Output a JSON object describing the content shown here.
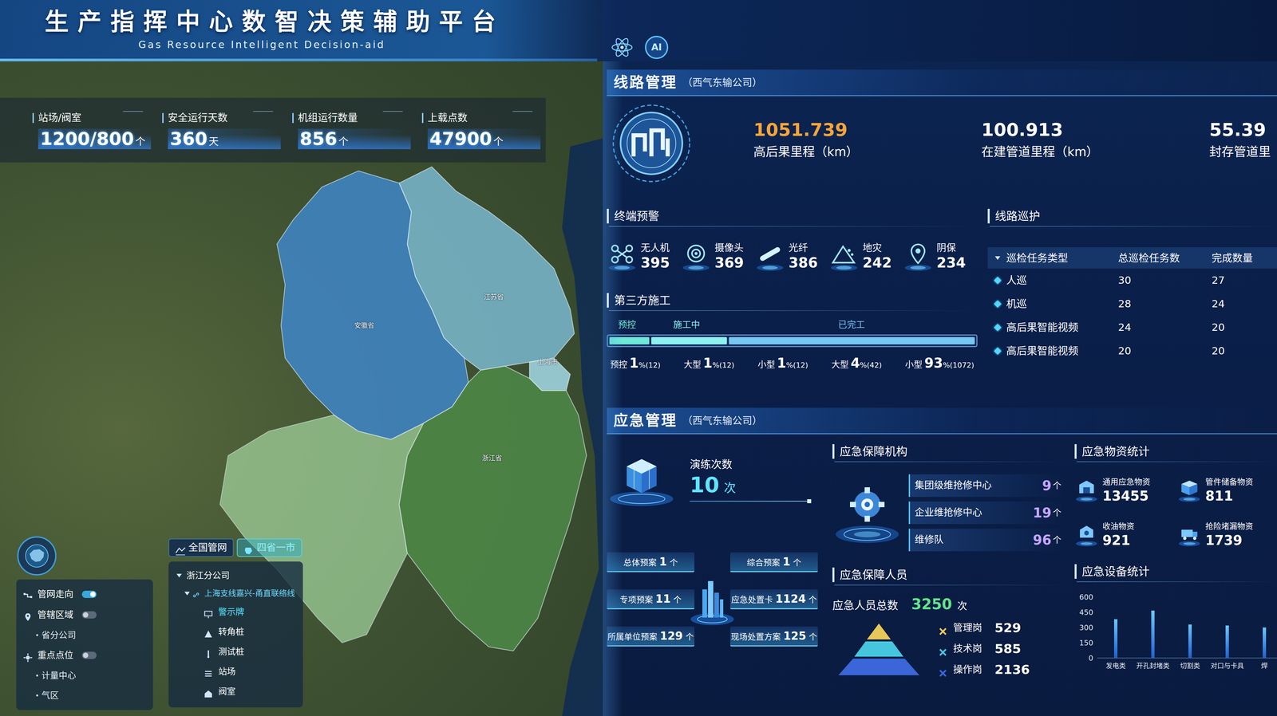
{
  "header": {
    "title": "生产指挥中心数智决策辅助平台",
    "subtitle": "Gas Resource Intelligent Decision-aid",
    "ai_badge": "AI"
  },
  "stats": [
    {
      "label": "站场/阀室",
      "value": "1200/800",
      "unit": "个"
    },
    {
      "label": "安全运行天数",
      "value": "360",
      "unit": "天"
    },
    {
      "label": "机组运行数量",
      "value": "856",
      "unit": "个"
    },
    {
      "label": "上载点数",
      "value": "47900",
      "unit": "个"
    }
  ],
  "map": {
    "provinces": [
      {
        "name": "安徽省",
        "color": "#3f86c8"
      },
      {
        "name": "江苏省",
        "color": "#7ab9cf"
      },
      {
        "name": "上海市",
        "color": "#a6dbe8"
      },
      {
        "name": "浙江省",
        "color": "#4f8a48"
      }
    ]
  },
  "layers": {
    "groups": [
      {
        "label": "管网走向",
        "on": true,
        "children": []
      },
      {
        "label": "管辖区域",
        "on": false,
        "children": [
          "省分公司"
        ]
      },
      {
        "label": "重点点位",
        "on": false,
        "children": [
          "计量中心",
          "气区"
        ]
      }
    ]
  },
  "tree": {
    "tabs": [
      {
        "label": "全国管网",
        "selected": false
      },
      {
        "label": "四省一市",
        "selected": true
      }
    ],
    "company": "浙江分公司",
    "line": "上海支线嘉兴-甬直联络线",
    "items": [
      {
        "label": "警示牌",
        "selected": true
      },
      {
        "label": "转角桩",
        "selected": false
      },
      {
        "label": "测试桩",
        "selected": false
      },
      {
        "label": "站场",
        "selected": false
      },
      {
        "label": "阀室",
        "selected": false
      }
    ]
  },
  "line_mgmt": {
    "title": "线路管理",
    "org": "（西气东输公司）",
    "kpis": [
      {
        "value": "1051.739",
        "label": "高后果里程（km）",
        "color": "#f5a43a"
      },
      {
        "value": "100.913",
        "label": "在建管道里程（km）",
        "color": "#ffffff"
      },
      {
        "value": "55.39",
        "label": "封存管道里",
        "color": "#ffffff"
      }
    ]
  },
  "terminal": {
    "title": "终端预警",
    "items": [
      {
        "label": "无人机",
        "value": "395"
      },
      {
        "label": "摄像头",
        "value": "369"
      },
      {
        "label": "光纤",
        "value": "386"
      },
      {
        "label": "地灾",
        "value": "242"
      },
      {
        "label": "阴保",
        "value": "234"
      }
    ]
  },
  "construction": {
    "title": "第三方施工",
    "bar": [
      {
        "label": "预控",
        "level": 0.11,
        "color": "#6fe8d8"
      },
      {
        "label": "施工中",
        "level": 0.21,
        "color": "#8ef0f0"
      },
      {
        "label": "已完工",
        "level": 0.68,
        "color": "#78c6f2"
      }
    ],
    "stats": [
      {
        "label": "预控",
        "value": "1",
        "unit": "%(12)"
      },
      {
        "label": "大型",
        "value": "1",
        "unit": "%(12)"
      },
      {
        "label": "小型",
        "value": "1",
        "unit": "%(12)"
      },
      {
        "label": "大型",
        "value": "4",
        "unit": "%(42)"
      },
      {
        "label": "小型",
        "value": "93",
        "unit": "%(1072)"
      }
    ]
  },
  "patrol": {
    "title": "线路巡护",
    "columns": [
      "巡检任务类型",
      "总巡检任务数",
      "完成数量"
    ],
    "rows": [
      [
        "人巡",
        "30",
        "27"
      ],
      [
        "机巡",
        "28",
        "24"
      ],
      [
        "高后果智能视频",
        "24",
        "20"
      ],
      [
        "高后果智能视频",
        "20",
        "20"
      ]
    ]
  },
  "emergency": {
    "title": "应急管理",
    "org": "（西气东输公司）",
    "drills": {
      "label": "演练次数",
      "value": "10",
      "unit": "次"
    },
    "plans": [
      {
        "label": "总体预案",
        "value": "1",
        "unit": "个"
      },
      {
        "label": "综合预案",
        "value": "1",
        "unit": "个"
      },
      {
        "label": "专项预案",
        "value": "11",
        "unit": "个"
      },
      {
        "label": "应急处置卡",
        "value": "1124",
        "unit": "个"
      },
      {
        "label": "所属单位预案",
        "value": "129",
        "unit": "个"
      },
      {
        "label": "现场处置方案",
        "value": "125",
        "unit": "个"
      }
    ],
    "agencies": {
      "title": "应急保障机构",
      "items": [
        {
          "label": "集团级维抢修中心",
          "value": "9",
          "unit": "个"
        },
        {
          "label": "企业维抢修中心",
          "value": "19",
          "unit": "个"
        },
        {
          "label": "维修队",
          "value": "96",
          "unit": "个"
        }
      ]
    },
    "personnel": {
      "title": "应急保障人员",
      "total_label": "应急人员总数",
      "total": "3250",
      "total_unit": "次",
      "items": [
        {
          "label": "管理岗",
          "value": "529",
          "color": "#e6c85a"
        },
        {
          "label": "技术岗",
          "value": "585",
          "color": "#45c6de"
        },
        {
          "label": "操作岗",
          "value": "2136",
          "color": "#3a66d8"
        }
      ]
    },
    "supplies": {
      "title": "应急物资统计",
      "items": [
        {
          "label": "通用应急物资",
          "value": "13455"
        },
        {
          "label": "管件储备物资",
          "value": "811"
        },
        {
          "label": "收油物资",
          "value": "921"
        },
        {
          "label": "抢险堵漏物资",
          "value": "1739"
        }
      ]
    },
    "equipment": {
      "title": "应急设备统计",
      "max": 600,
      "ticks": [
        "600",
        "450",
        "300",
        "150",
        "0"
      ],
      "categories": [
        "发电类",
        "开孔封堵类",
        "切割类",
        "对口与卡具",
        "焊"
      ],
      "values": [
        385,
        470,
        330,
        320,
        300
      ]
    }
  }
}
